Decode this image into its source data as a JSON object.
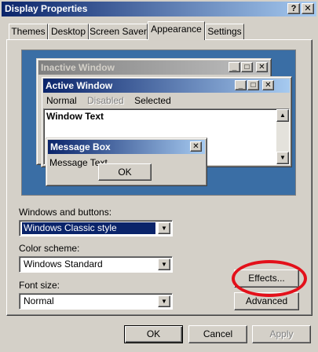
{
  "window": {
    "title": "Display Properties",
    "help_button": "?",
    "close_button": "✕"
  },
  "tabs": [
    {
      "label": "Themes"
    },
    {
      "label": "Desktop"
    },
    {
      "label": "Screen Saver"
    },
    {
      "label": "Appearance",
      "active": true
    },
    {
      "label": "Settings"
    }
  ],
  "preview": {
    "inactive_title": "Inactive Window",
    "active_title": "Active Window",
    "menu": {
      "normal": "Normal",
      "disabled": "Disabled",
      "selected": "Selected"
    },
    "window_text": "Window Text",
    "message_box": {
      "title": "Message Box",
      "text": "Message Text",
      "ok": "OK"
    }
  },
  "controls": {
    "windows_buttons": {
      "label": "Windows and buttons:",
      "value": "Windows Classic style"
    },
    "color_scheme": {
      "label": "Color scheme:",
      "value": "Windows Standard"
    },
    "font_size": {
      "label": "Font size:",
      "value": "Normal"
    },
    "effects_button": "Effects...",
    "advanced_button": "Advanced"
  },
  "footer": {
    "ok": "OK",
    "cancel": "Cancel",
    "apply": "Apply"
  },
  "colors": {
    "annotation": "#e3101a",
    "desktop": "#3a6ea5",
    "active_title": "#0a246a"
  }
}
